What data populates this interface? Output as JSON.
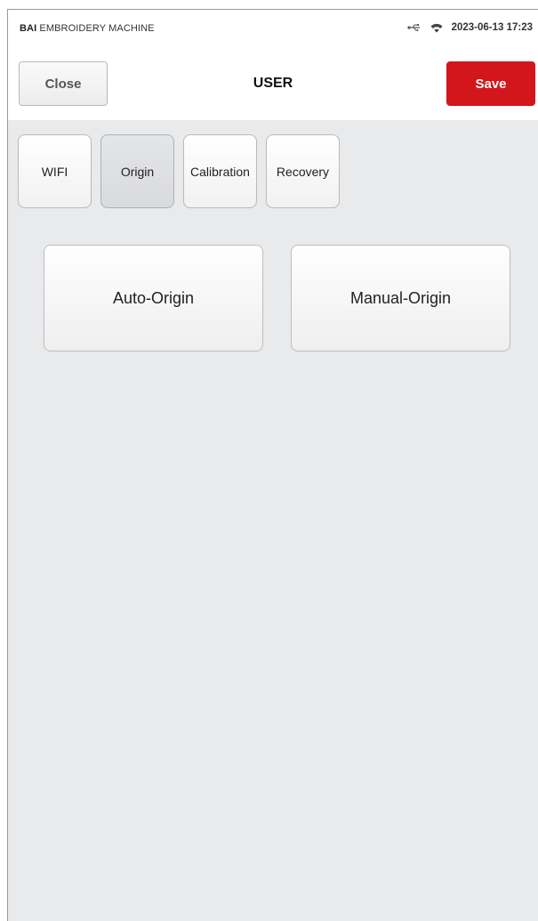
{
  "status_bar": {
    "brand_bold": "BAI",
    "brand_rest": " EMBROIDERY MACHINE",
    "datetime": "2023-06-13 17:23",
    "icons": [
      "usb-icon",
      "wifi-icon"
    ]
  },
  "header": {
    "close_label": "Close",
    "title": "USER",
    "save_label": "Save",
    "save_color": "#d3151c"
  },
  "tabs": [
    {
      "label": "WIFI",
      "active": false
    },
    {
      "label": "Origin",
      "active": true
    },
    {
      "label": "Calibration",
      "active": false
    },
    {
      "label": "Recovery",
      "active": false
    }
  ],
  "actions": [
    {
      "label": "Auto-Origin"
    },
    {
      "label": "Manual-Origin"
    }
  ]
}
